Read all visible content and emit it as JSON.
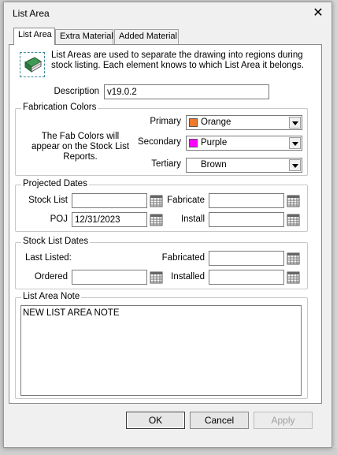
{
  "window": {
    "title": "List Area",
    "close_glyph": "✕"
  },
  "tabs": [
    {
      "label": "List Area",
      "active": true
    },
    {
      "label": "Extra Material",
      "active": false
    },
    {
      "label": "Added Material",
      "active": false
    }
  ],
  "intro": {
    "icon": "book-icon",
    "text": "List Areas are used to separate the drawing into regions during stock listing. Each element knows to which List Area it belongs."
  },
  "description": {
    "label": "Description",
    "value": "v19.0.2"
  },
  "fabrication_colors": {
    "title": "Fabrication Colors",
    "note": "The Fab Colors will appear on the Stock List Reports.",
    "primary": {
      "label": "Primary",
      "value": "Orange",
      "swatch": "#f07a28"
    },
    "secondary": {
      "label": "Secondary",
      "value": "Purple",
      "swatch": "#ff00ff"
    },
    "tertiary": {
      "label": "Tertiary",
      "value": "Brown"
    }
  },
  "projected_dates": {
    "title": "Projected Dates",
    "stock_list": {
      "label": "Stock List",
      "value": ""
    },
    "fabricate": {
      "label": "Fabricate",
      "value": ""
    },
    "poj": {
      "label": "POJ",
      "value": "12/31/2023"
    },
    "install": {
      "label": "Install",
      "value": ""
    }
  },
  "stock_list_dates": {
    "title": "Stock List Dates",
    "last_listed": {
      "label": "Last Listed:"
    },
    "fabricated": {
      "label": "Fabricated",
      "value": ""
    },
    "ordered": {
      "label": "Ordered",
      "value": ""
    },
    "installed": {
      "label": "Installed",
      "value": ""
    }
  },
  "list_area_note": {
    "title": "List Area Note",
    "value": "NEW LIST AREA NOTE"
  },
  "buttons": {
    "ok": "OK",
    "cancel": "Cancel",
    "apply": "Apply"
  }
}
